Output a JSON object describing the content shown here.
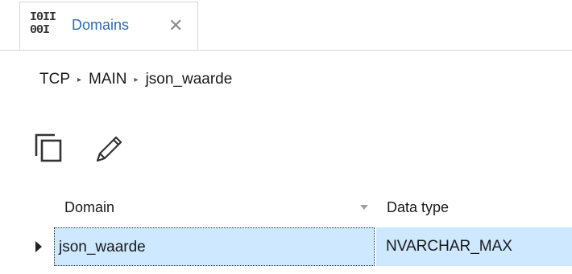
{
  "tab": {
    "icon": "binary-table-icon",
    "icon_rows": [
      "I0II",
      "00I"
    ],
    "label": "Domains",
    "close_glyph": "✕"
  },
  "breadcrumb": {
    "items": [
      "TCP",
      "MAIN",
      "json_waarde"
    ],
    "separator": "▸"
  },
  "toolbar": {
    "buttons": [
      {
        "icon": "copy-icon"
      },
      {
        "icon": "edit-pencil-icon"
      }
    ]
  },
  "grid": {
    "columns": [
      {
        "label": "Domain",
        "sort": "descending"
      },
      {
        "label": "Data type"
      }
    ],
    "rows": [
      {
        "domain": "json_waarde",
        "data_type": "NVARCHAR_MAX",
        "selected": true
      }
    ],
    "selection_color": "#cde8ff"
  },
  "colors": {
    "tab_label": "#2b6cb0",
    "border": "#d6d6d6"
  }
}
